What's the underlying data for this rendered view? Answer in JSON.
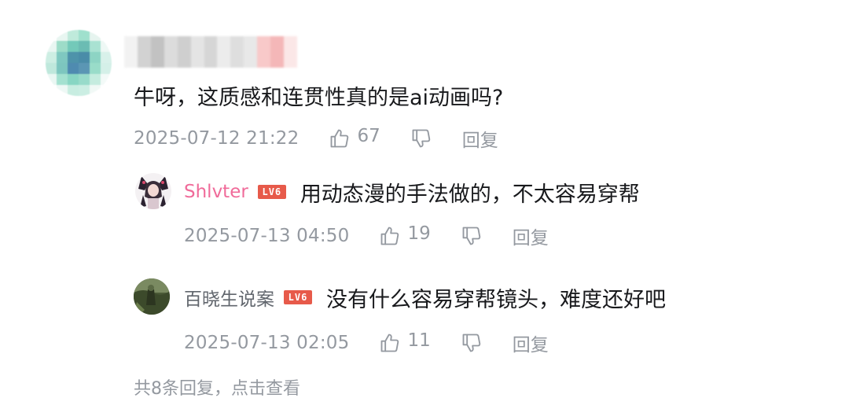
{
  "main_comment": {
    "text": "牛呀，这质感和连贯性真的是ai动画吗?",
    "time": "2025-07-12 21:22",
    "likes": "67",
    "reply_label": "回复"
  },
  "replies": [
    {
      "username": "Shlvter",
      "level": "LV6",
      "name_color": "#f06b9a",
      "text": "用动态漫的手法做的，不太容易穿帮",
      "time": "2025-07-13 04:50",
      "likes": "19",
      "reply_label": "回复"
    },
    {
      "username": "百晓生说案",
      "level": "LV6",
      "name_color": "#61666d",
      "text": "没有什么容易穿帮镜头，难度还好吧",
      "time": "2025-07-13 02:05",
      "likes": "11",
      "reply_label": "回复"
    }
  ],
  "more_replies": "共8条回复，点击查看",
  "colors": {
    "meta_gray": "#9499a0",
    "level_badge": "#e75a4a",
    "text": "#18191c"
  },
  "icons": [
    "thumbs-up-icon",
    "thumbs-down-icon"
  ]
}
